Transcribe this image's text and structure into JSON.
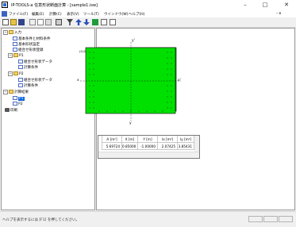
{
  "window": {
    "title": "IP-TOOLS-a 任意形状断面計算 - [sample1.isw]",
    "minimize": "–",
    "maximize": "□",
    "close": "✕"
  },
  "menu": {
    "items": [
      "ファイル(F)",
      "編集(E)",
      "計算(C)",
      "表示(V)",
      "ツール(T)",
      "ウインドウ(W)",
      "ヘルプ(H)"
    ],
    "restore": "– ɐ"
  },
  "toolbar": {
    "buttons": [
      "new-icon",
      "open-icon",
      "save-icon",
      "cut-icon",
      "copy-icon",
      "paste-icon",
      "print-icon",
      "filter-icon",
      "arrow-up-icon",
      "arrow-down-icon",
      "list-icon",
      "grid-icon",
      "help-icon"
    ]
  },
  "tree": {
    "items": [
      {
        "label": "入力",
        "level": 0,
        "icon": "folder-icon",
        "expander": "−"
      },
      {
        "label": "基本条件と材料条件",
        "level": 1,
        "icon": "doc-icon"
      },
      {
        "label": "基本形状設定",
        "level": 1,
        "icon": "doc-icon"
      },
      {
        "label": "組合せ形状登録",
        "level": 1,
        "icon": "doc-icon"
      },
      {
        "label": "P1",
        "level": 1,
        "icon": "folder-icon",
        "expander": "−"
      },
      {
        "label": "組合せ形状データ",
        "level": 2,
        "icon": "doc-icon"
      },
      {
        "label": "計算条件",
        "level": 2,
        "icon": "doc-icon"
      },
      {
        "label": "P2",
        "level": 1,
        "icon": "folder-icon",
        "expander": "−"
      },
      {
        "label": "組合せ形状データ",
        "level": 2,
        "icon": "doc-icon"
      },
      {
        "label": "計算条件",
        "level": 2,
        "icon": "doc-icon"
      },
      {
        "label": "計算結果",
        "level": 0,
        "icon": "folder-icon",
        "expander": "−"
      },
      {
        "label": "P1",
        "level": 1,
        "icon": "doc-icon",
        "selected": true
      },
      {
        "label": "P2",
        "level": 1,
        "icon": "doc-icon"
      },
      {
        "label": "印刷",
        "level": 0,
        "icon": "printer-icon"
      }
    ]
  },
  "figure": {
    "axis_y_top": "y'",
    "axis_y_bottom": "y",
    "axis_x_left": "x",
    "axis_x_right": "x'",
    "corner_label": "(0,0)",
    "fill_color": "#00e000"
  },
  "results_table": {
    "headers": [
      "A [m²]",
      "X [m]",
      "Y [m]",
      "Ix [m⁴]",
      "Iy [m⁴]"
    ],
    "rows": [
      [
        "5.69724",
        "0.85000",
        "-1.00000",
        "2.07425",
        "3.85431"
      ]
    ]
  },
  "status": {
    "text": "ヘルプを表示するには [F1] を押してください。"
  }
}
